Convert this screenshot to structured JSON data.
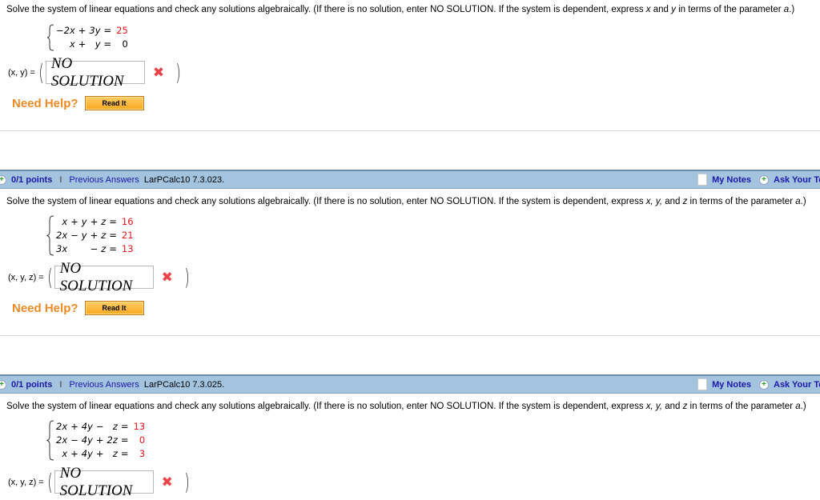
{
  "problems": [
    {
      "prompt": {
        "before": "Solve the system of linear equations and check any solutions algebraically. (If there is no solution, enter NO SOLUTION. If the system is dependent, express ",
        "vars": "x",
        "mid": " and ",
        "vars2": "y",
        "after": " in terms of the parameter ",
        "param": "a",
        "end": ".)"
      },
      "equations": [
        {
          "lhs": [
            "−2x",
            "+",
            "3y"
          ],
          "eq": "=",
          "rhs": "25",
          "rhs_color": "#e8141a"
        },
        {
          "lhs": [
            "x",
            "+",
            "y"
          ],
          "eq": "=",
          "rhs": "0",
          "rhs_color": "#000000"
        }
      ],
      "answer_label": "(x, y) =",
      "answer_value": "NO SOLUTION",
      "status_icon": "x-mark-icon",
      "need_help": "Need Help?",
      "read_it": "Read It"
    },
    {
      "header": {
        "points": "0/1 points",
        "separator": "I",
        "previous_answers": "Previous Answers",
        "code": "LarPCalc10 7.3.023.",
        "my_notes": "My Notes",
        "ask_teacher": "Ask Your Teacher"
      },
      "prompt": {
        "before": "Solve the system of linear equations and check any solutions algebraically. (If there is no solution, enter NO SOLUTION. If the system is dependent, express ",
        "vars": "x, y,",
        "mid": " and ",
        "vars2": "z",
        "after": " in terms of the parameter ",
        "param": "a",
        "end": ".)"
      },
      "equations": [
        {
          "lhs": [
            "x",
            "+",
            "y",
            "+",
            "z"
          ],
          "eq": "=",
          "rhs": "16"
        },
        {
          "lhs": [
            "2x",
            "−",
            "y",
            "+",
            "z"
          ],
          "eq": "=",
          "rhs": "21"
        },
        {
          "lhs": [
            "3x",
            "",
            "",
            "−",
            "z"
          ],
          "eq": "=",
          "rhs": "13"
        }
      ],
      "answer_label": "(x, y, z) =",
      "answer_value": "NO SOLUTION",
      "status_icon": "x-mark-icon",
      "need_help": "Need Help?",
      "read_it": "Read It"
    },
    {
      "header": {
        "points": "0/1 points",
        "separator": "I",
        "previous_answers": "Previous Answers",
        "code": "LarPCalc10 7.3.025.",
        "my_notes": "My Notes",
        "ask_teacher": "Ask Your Teacher"
      },
      "prompt": {
        "before": "Solve the system of linear equations and check any solutions algebraically. (If there is no solution, enter NO SOLUTION. If the system is dependent, express ",
        "vars": "x, y,",
        "mid": " and ",
        "vars2": "z",
        "after": " in terms of the parameter ",
        "param": "a",
        "end": ".)"
      },
      "equations": [
        {
          "lhs": [
            "2x",
            "+",
            "4y",
            "−",
            "z"
          ],
          "eq": "=",
          "rhs": "13"
        },
        {
          "lhs": [
            "2x",
            "−",
            "4y",
            "+",
            "2z"
          ],
          "eq": "=",
          "rhs": "0"
        },
        {
          "lhs": [
            "x",
            "+",
            "4y",
            "+",
            "z"
          ],
          "eq": "=",
          "rhs": "3"
        }
      ],
      "answer_label": "(x, y, z) =",
      "answer_value": "NO SOLUTION",
      "status_icon": "x-mark-icon"
    }
  ],
  "colors": {
    "link_blue": "#1a1aa6",
    "rhs_red": "#e8141a",
    "help_orange": "#f08a24",
    "header_bar": "#a3c3df",
    "wrong_x": "#e8454a"
  }
}
